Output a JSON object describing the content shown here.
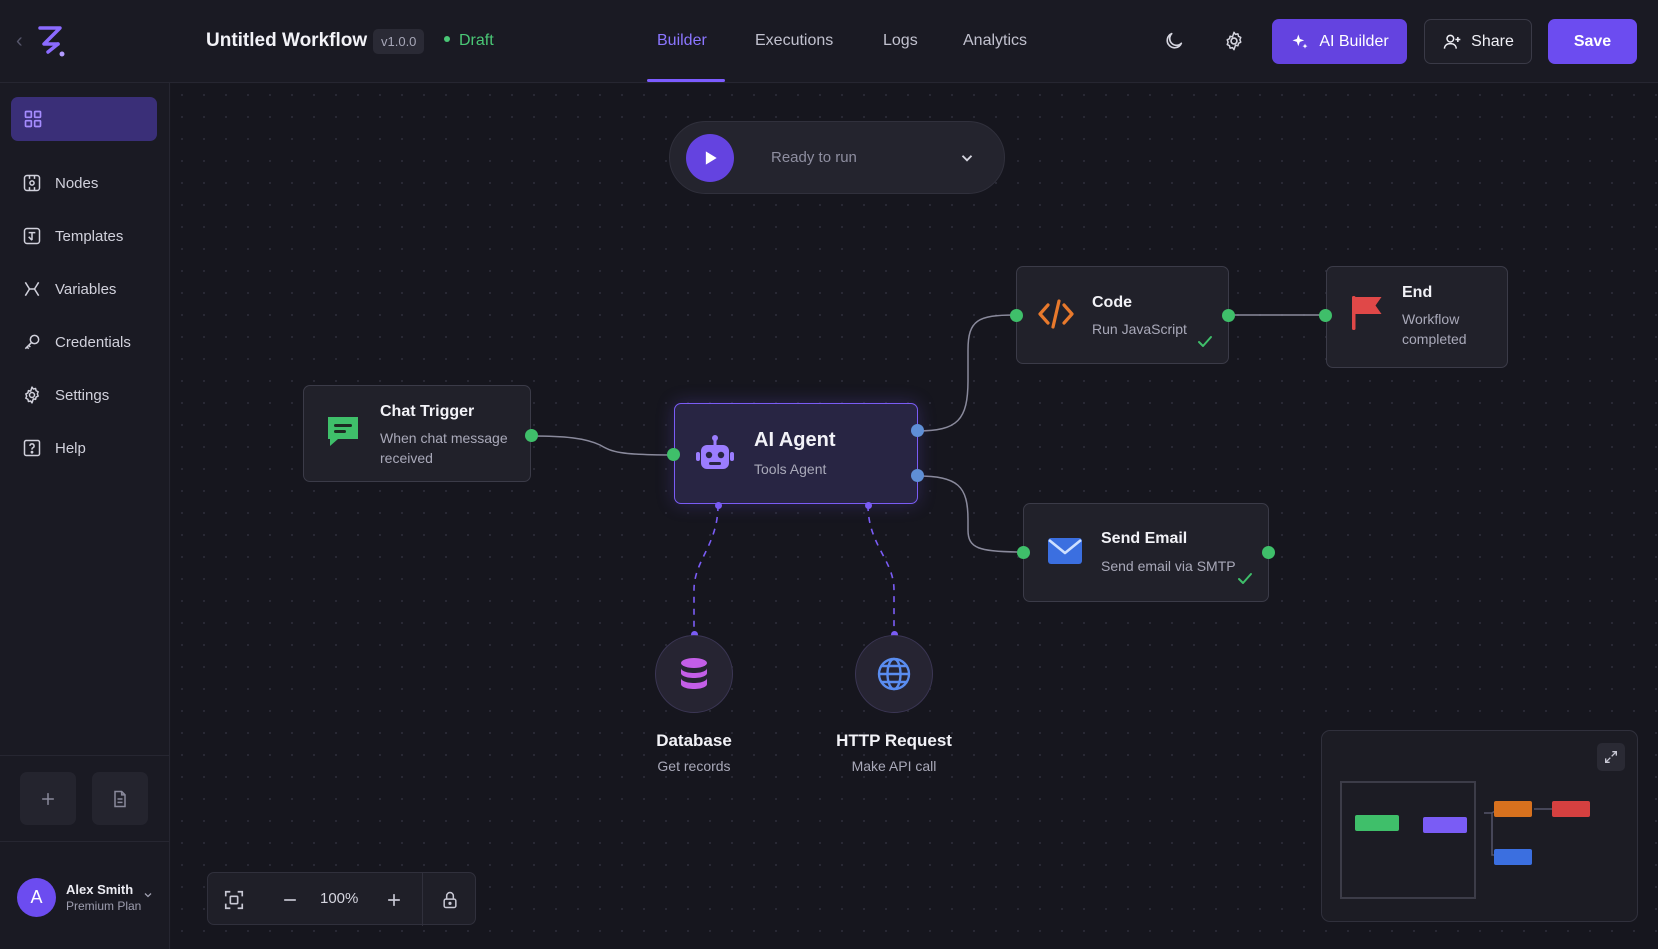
{
  "header": {
    "title": "Untitled Workflow",
    "version": "v1.0.0",
    "status": "Draft",
    "tabs": [
      "Builder",
      "Executions",
      "Logs",
      "Analytics"
    ],
    "active_tab": "Builder",
    "ai_builder_label": "AI Builder",
    "share_label": "Share",
    "save_label": "Save"
  },
  "sidebar": {
    "items": [
      "Nodes",
      "Templates",
      "Variables",
      "Credentials",
      "Settings",
      "Help"
    ],
    "user": {
      "initial": "A",
      "name": "Alex Smith",
      "plan": "Premium Plan"
    }
  },
  "run_bar": {
    "status": "Ready to run"
  },
  "nodes": {
    "chat_trigger": {
      "title": "Chat Trigger",
      "subtitle_line1": "When chat message",
      "subtitle_line2": "received"
    },
    "ai_agent": {
      "title": "AI Agent",
      "subtitle": "Tools Agent"
    },
    "code": {
      "title": "Code",
      "subtitle": "Run JavaScript"
    },
    "end": {
      "title": "End",
      "subtitle_line1": "Workflow",
      "subtitle_line2": "completed"
    },
    "send_email": {
      "title": "Send Email",
      "subtitle": "Send email via SMTP"
    },
    "database": {
      "title": "Database",
      "subtitle": "Get records"
    },
    "http_request": {
      "title": "HTTP Request",
      "subtitle": "Make API call"
    }
  },
  "zoom": {
    "level": "100%"
  },
  "colors": {
    "accent": "#6c4cf0",
    "status_green": "#4ac776",
    "code_orange": "#e8792c",
    "end_red": "#e04848",
    "email_blue": "#3b6fe0"
  }
}
